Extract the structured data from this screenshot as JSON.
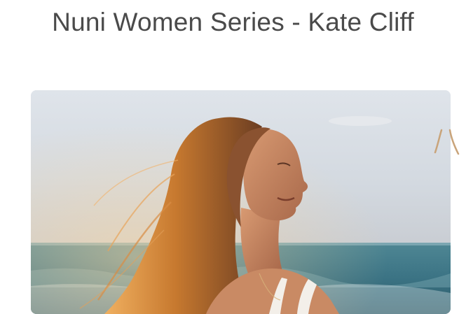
{
  "page": {
    "title": "Nuni Women Series - Kate Cliff"
  },
  "hero_image": {
    "subject": "portrait-photo",
    "scene": "woman-at-beach-sunset"
  },
  "carousel": {
    "next_slide_peek": "decorative-stroke-icon"
  },
  "colors": {
    "title_text": "#4a4a4a",
    "background": "#ffffff",
    "sky": "#d4dbe3",
    "sea": "#3d7d8c",
    "hair": "#c8803a",
    "skin": "#c98a64",
    "accent_peek": "#c9a47a"
  }
}
